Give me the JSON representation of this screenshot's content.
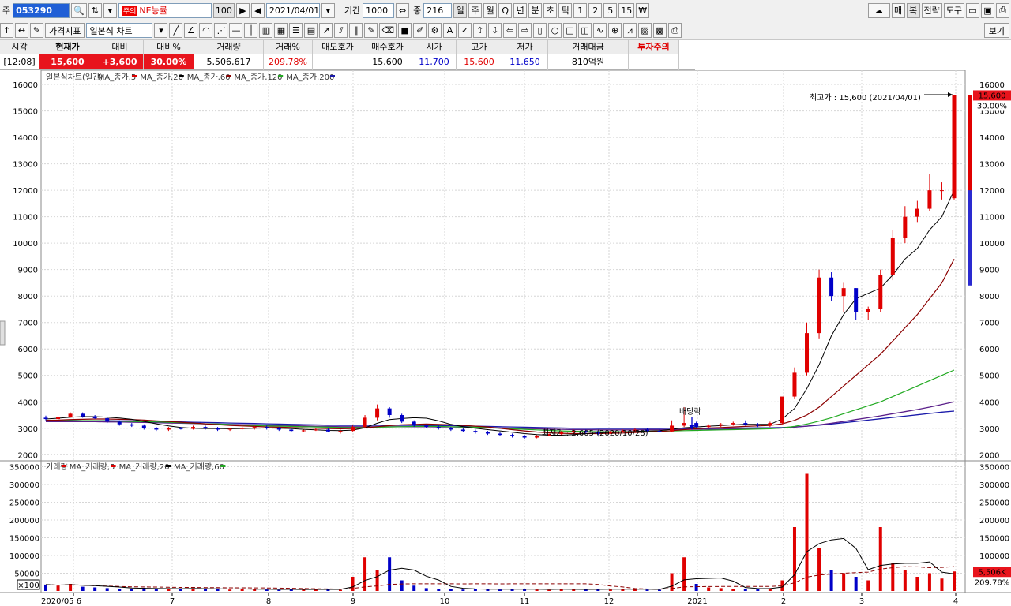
{
  "toolbar1": {
    "code_label": "주",
    "code": "053290",
    "stock_badge": "주의",
    "stock_name": "NE능률",
    "stock_num": "100",
    "date": "2021/04/01",
    "period_label": "기간",
    "period": "1000",
    "view_label": "중",
    "view": "216",
    "periods": [
      "일",
      "주",
      "월",
      "Q",
      "년",
      "분",
      "초",
      "틱",
      "1",
      "2",
      "5",
      "15",
      "₩"
    ],
    "right_buttons": [
      "매",
      "복",
      "전략",
      "도구"
    ]
  },
  "toolbar2": {
    "indicator_label": "가격지표",
    "chart_type": "일본식 차트",
    "view_button": "보기"
  },
  "quote": {
    "headers": [
      "시각",
      "현재가",
      "대비",
      "대비%",
      "거래량",
      "거래%",
      "매도호가",
      "매수호가",
      "시가",
      "고가",
      "저가",
      "거래대금",
      "투자주의"
    ],
    "values": [
      "[12:08]",
      "15,600",
      "+3,600",
      "30.00%",
      "5,506,617",
      "209.78%",
      "",
      "15,600",
      "11,700",
      "15,600",
      "11,650",
      "810억원",
      ""
    ]
  },
  "colors": {
    "up": "#e00000",
    "down": "#0000c8",
    "ma5": "#000000",
    "ma20": "#8b0000",
    "ma60": "#22aa22",
    "ma120": "#5a1f8a",
    "ma200": "#1a1aaa"
  },
  "chart_data": {
    "type": "candlestick",
    "legend_price": [
      "일본식차트(일간)",
      "MA_종가,5",
      "MA_종가,20",
      "MA_종가,60",
      "MA_종가,120",
      "MA_종가,200"
    ],
    "legend_volume": [
      "거래량",
      "MA_거래량,5",
      "MA_거래량,20",
      "MA_거래량,60"
    ],
    "price_axis": [
      2000,
      3000,
      4000,
      5000,
      6000,
      7000,
      8000,
      9000,
      10000,
      11000,
      12000,
      13000,
      14000,
      15000,
      16000
    ],
    "price_labels": [
      "2000",
      "3000",
      "4000",
      "5000",
      "6000",
      "7000",
      "8000",
      "9000",
      "10000",
      "11000",
      "12000",
      "13000",
      "14000",
      "15000",
      "16000"
    ],
    "volume_axis": [
      50000,
      100000,
      150000,
      200000,
      250000,
      300000,
      350000
    ],
    "volume_labels": [
      "50000",
      "100000",
      "150000",
      "200000",
      "250000",
      "300000",
      "350000"
    ],
    "x_labels": [
      "2020/05 6",
      "7",
      "8",
      "9",
      "10",
      "11",
      "12",
      "2021",
      "2",
      "3",
      "4"
    ],
    "ylim_price": [
      1800,
      16300
    ],
    "ylim_volume": [
      0,
      360000
    ],
    "max_label": "최고가 : 15,600 (2021/04/01)",
    "min_label": "최저가 : 2,605 (2020/10/28)",
    "event_label": "배당락",
    "current_price": "15,600",
    "current_pct": "30.00%",
    "current_volume": "5,506K",
    "current_vol_pct": "209.78%",
    "volume_scale": "×100",
    "candles": [
      [
        3400,
        3480,
        3300,
        3350
      ],
      [
        3350,
        3450,
        3300,
        3420
      ],
      [
        3420,
        3600,
        3400,
        3550
      ],
      [
        3550,
        3600,
        3400,
        3450
      ],
      [
        3450,
        3500,
        3350,
        3380
      ],
      [
        3380,
        3420,
        3200,
        3250
      ],
      [
        3250,
        3300,
        3100,
        3150
      ],
      [
        3150,
        3200,
        3050,
        3100
      ],
      [
        3100,
        3150,
        2950,
        3000
      ],
      [
        3000,
        3050,
        2900,
        2950
      ],
      [
        2950,
        3050,
        2900,
        3000
      ],
      [
        3000,
        3050,
        2950,
        2980
      ],
      [
        2980,
        3100,
        2950,
        3050
      ],
      [
        3050,
        3100,
        2950,
        3000
      ],
      [
        3000,
        3050,
        2900,
        2950
      ],
      [
        2950,
        3000,
        2900,
        2980
      ],
      [
        2980,
        3050,
        2950,
        3000
      ],
      [
        3000,
        3100,
        2950,
        3050
      ],
      [
        3050,
        3100,
        2950,
        3000
      ],
      [
        3000,
        3050,
        2900,
        2950
      ],
      [
        2950,
        3000,
        2850,
        2900
      ],
      [
        2900,
        2950,
        2850,
        2920
      ],
      [
        2920,
        3000,
        2900,
        2950
      ],
      [
        2950,
        3000,
        2850,
        2880
      ],
      [
        2880,
        2950,
        2800,
        2900
      ],
      [
        2900,
        3100,
        2880,
        3050
      ],
      [
        3050,
        3500,
        3000,
        3400
      ],
      [
        3400,
        3900,
        3300,
        3750
      ],
      [
        3750,
        3800,
        3400,
        3500
      ],
      [
        3500,
        3550,
        3200,
        3250
      ],
      [
        3250,
        3300,
        3050,
        3100
      ],
      [
        3100,
        3150,
        3000,
        3050
      ],
      [
        3050,
        3100,
        2950,
        3000
      ],
      [
        3000,
        3050,
        2900,
        2950
      ],
      [
        2950,
        3000,
        2850,
        2900
      ],
      [
        2900,
        2950,
        2800,
        2850
      ],
      [
        2850,
        2900,
        2750,
        2800
      ],
      [
        2800,
        2850,
        2700,
        2750
      ],
      [
        2750,
        2800,
        2650,
        2700
      ],
      [
        2700,
        2750,
        2605,
        2650
      ],
      [
        2650,
        2750,
        2620,
        2720
      ],
      [
        2720,
        2800,
        2700,
        2780
      ],
      [
        2780,
        2900,
        2750,
        2850
      ],
      [
        2850,
        2950,
        2800,
        2900
      ],
      [
        2900,
        2950,
        2800,
        2850
      ],
      [
        2850,
        2900,
        2750,
        2800
      ],
      [
        2800,
        2900,
        2780,
        2880
      ],
      [
        2880,
        2950,
        2850,
        2900
      ],
      [
        2900,
        3000,
        2880,
        2950
      ],
      [
        2950,
        3000,
        2850,
        2900
      ],
      [
        2900,
        2950,
        2850,
        2880
      ],
      [
        2880,
        3300,
        2850,
        3100
      ],
      [
        3100,
        3800,
        3050,
        3200
      ],
      [
        3200,
        3250,
        3000,
        3050
      ],
      [
        3050,
        3150,
        3000,
        3100
      ],
      [
        3100,
        3200,
        3050,
        3150
      ],
      [
        3150,
        3250,
        3100,
        3200
      ],
      [
        3200,
        3300,
        3100,
        3150
      ],
      [
        3150,
        3200,
        3050,
        3100
      ],
      [
        3100,
        3250,
        3050,
        3200
      ],
      [
        3200,
        3900,
        3150,
        4200
      ],
      [
        4200,
        5300,
        4100,
        5100
      ],
      [
        5100,
        7000,
        5000,
        6600
      ],
      [
        6600,
        9000,
        6400,
        8700
      ],
      [
        8700,
        8900,
        7800,
        8000
      ],
      [
        8000,
        8500,
        7400,
        8300
      ],
      [
        8300,
        8300,
        7100,
        7400
      ],
      [
        7400,
        7600,
        7100,
        7500
      ],
      [
        7500,
        9000,
        7400,
        8800
      ],
      [
        8800,
        10500,
        8600,
        10200
      ],
      [
        10200,
        11400,
        10000,
        11000
      ],
      [
        11000,
        11600,
        10800,
        11300
      ],
      [
        11300,
        12600,
        11200,
        12000
      ],
      [
        12000,
        12300,
        11650,
        12000
      ],
      [
        11700,
        15600,
        11650,
        15600
      ]
    ],
    "volumes": [
      18000,
      15000,
      20000,
      12000,
      10000,
      8000,
      6000,
      5000,
      9000,
      7000,
      6000,
      5000,
      8000,
      6000,
      5000,
      4000,
      6000,
      5000,
      4000,
      3000,
      5000,
      4000,
      6000,
      4000,
      3000,
      40000,
      95000,
      60000,
      95000,
      30000,
      15000,
      8000,
      6000,
      5000,
      4000,
      6000,
      5000,
      4000,
      6000,
      5000,
      4000,
      3000,
      6000,
      5000,
      4000,
      5000,
      4000,
      6000,
      5000,
      4000,
      3000,
      50000,
      95000,
      20000,
      10000,
      8000,
      6000,
      5000,
      6000,
      8000,
      30000,
      180000,
      330000,
      120000,
      60000,
      50000,
      40000,
      30000,
      180000,
      80000,
      60000,
      40000,
      50000,
      35000,
      55000
    ],
    "ma5": [
      3350,
      3380,
      3420,
      3440,
      3440,
      3420,
      3390,
      3340,
      3260,
      3170,
      3090,
      3030,
      3000,
      2990,
      2990,
      2980,
      2990,
      3000,
      3010,
      3000,
      2990,
      2960,
      2940,
      2920,
      2910,
      2930,
      3020,
      3190,
      3330,
      3370,
      3400,
      3380,
      3280,
      3150,
      3060,
      3000,
      2950,
      2900,
      2850,
      2800,
      2760,
      2740,
      2740,
      2760,
      2800,
      2830,
      2840,
      2860,
      2880,
      2900,
      2910,
      2960,
      3020,
      3050,
      3080,
      3100,
      3130,
      3150,
      3150,
      3150,
      3350,
      3750,
      4500,
      5400,
      6500,
      7300,
      7900,
      8100,
      8300,
      8800,
      9400,
      9800,
      10500,
      11000,
      12000
    ],
    "ma20": [
      3300,
      3310,
      3330,
      3340,
      3350,
      3350,
      3340,
      3330,
      3310,
      3280,
      3260,
      3230,
      3200,
      3170,
      3140,
      3110,
      3090,
      3070,
      3050,
      3040,
      3030,
      3010,
      3000,
      2990,
      2980,
      2990,
      3020,
      3060,
      3100,
      3130,
      3150,
      3160,
      3150,
      3130,
      3110,
      3080,
      3050,
      3000,
      2950,
      2900,
      2860,
      2830,
      2810,
      2800,
      2800,
      2800,
      2810,
      2820,
      2840,
      2860,
      2880,
      2910,
      2950,
      2980,
      3010,
      3030,
      3050,
      3070,
      3090,
      3110,
      3170,
      3300,
      3500,
      3800,
      4200,
      4600,
      5000,
      5400,
      5800,
      6300,
      6800,
      7300,
      7900,
      8500,
      9400
    ],
    "ma60": [
      3280,
      3280,
      3290,
      3290,
      3290,
      3280,
      3270,
      3260,
      3250,
      3240,
      3230,
      3210,
      3190,
      3170,
      3160,
      3140,
      3120,
      3100,
      3090,
      3080,
      3070,
      3060,
      3050,
      3040,
      3030,
      3030,
      3030,
      3040,
      3050,
      3060,
      3070,
      3070,
      3070,
      3060,
      3050,
      3040,
      3020,
      3000,
      2980,
      2960,
      2940,
      2920,
      2900,
      2890,
      2880,
      2870,
      2870,
      2870,
      2870,
      2880,
      2890,
      2900,
      2910,
      2920,
      2930,
      2940,
      2950,
      2960,
      2970,
      2980,
      3010,
      3070,
      3160,
      3270,
      3400,
      3550,
      3700,
      3850,
      4000,
      4200,
      4400,
      4600,
      4800,
      5000,
      5200
    ],
    "ma120": [
      3250,
      3250,
      3250,
      3250,
      3250,
      3240,
      3240,
      3230,
      3220,
      3210,
      3200,
      3190,
      3180,
      3170,
      3160,
      3150,
      3140,
      3130,
      3120,
      3110,
      3100,
      3090,
      3080,
      3070,
      3060,
      3060,
      3060,
      3060,
      3060,
      3060,
      3060,
      3060,
      3050,
      3050,
      3040,
      3030,
      3020,
      3010,
      3000,
      2990,
      2980,
      2970,
      2960,
      2950,
      2950,
      2940,
      2940,
      2940,
      2940,
      2950,
      2950,
      2950,
      2960,
      2960,
      2970,
      2970,
      2980,
      2980,
      2990,
      3000,
      3010,
      3040,
      3080,
      3130,
      3190,
      3260,
      3330,
      3400,
      3470,
      3550,
      3630,
      3710,
      3800,
      3900,
      4000
    ],
    "ma200": [
      3300,
      3300,
      3300,
      3290,
      3290,
      3290,
      3280,
      3280,
      3270,
      3260,
      3250,
      3240,
      3230,
      3220,
      3210,
      3200,
      3190,
      3180,
      3170,
      3160,
      3150,
      3140,
      3130,
      3120,
      3110,
      3110,
      3110,
      3110,
      3110,
      3110,
      3110,
      3100,
      3100,
      3100,
      3090,
      3080,
      3070,
      3060,
      3050,
      3040,
      3030,
      3020,
      3010,
      3000,
      3000,
      2990,
      2990,
      2990,
      2990,
      2990,
      2990,
      3000,
      3000,
      3000,
      3000,
      3010,
      3010,
      3010,
      3020,
      3020,
      3030,
      3050,
      3080,
      3120,
      3160,
      3210,
      3260,
      3310,
      3360,
      3410,
      3460,
      3510,
      3560,
      3610,
      3650
    ]
  }
}
